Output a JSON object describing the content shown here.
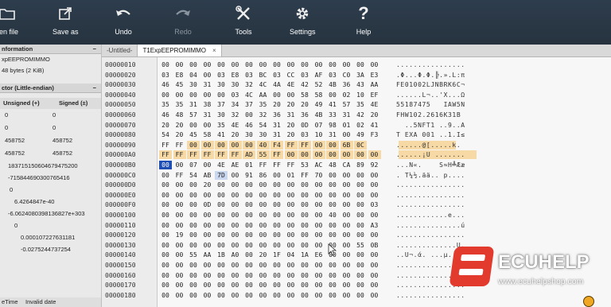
{
  "toolbar": {
    "open": "pen file",
    "save_as": "Save as",
    "undo": "Undo",
    "redo": "Redo",
    "tools": "Tools",
    "settings": "Settings",
    "help": "Help"
  },
  "sidebar": {
    "info_title": "nformation",
    "file_name": "xpEEPROMIMMO",
    "file_size": "48 bytes (2 KiB)",
    "vector_title": "ctor (Little-endian)",
    "col_unsigned": "Unsigned (+)",
    "col_signed": "Signed (±)",
    "rows": [
      {
        "a": "0",
        "b": "0"
      },
      {
        "a": "0",
        "b": "0"
      },
      {
        "a": "458752",
        "b": "458752"
      },
      {
        "a": "458752",
        "b": "458752"
      }
    ],
    "singles": [
      "18371515060467947520​0",
      "-715844690300765416",
      "0",
      "6.4264847e-40",
      "-6.0624080398136827e+303",
      "0",
      "0.000107227631181",
      "-0.0275244737254"
    ],
    "bottom_label": "eTime",
    "bottom_value": "Invalid date"
  },
  "tabs": [
    {
      "label": "-Untitled-",
      "active": false
    },
    {
      "label": "T1ExpEEPROMIMMO",
      "active": true
    }
  ],
  "hex": {
    "offsets": [
      "00000010",
      "00000020",
      "00000030",
      "00000040",
      "00000050",
      "00000060",
      "00000070",
      "00000080",
      "00000090",
      "000000A0",
      "000000B0",
      "000000C0",
      "000000D0",
      "000000E0",
      "000000F0",
      "00000100",
      "00000110",
      "00000120",
      "00000130",
      "00000140",
      "00000150",
      "00000160",
      "00000170",
      "00000180"
    ],
    "rows": [
      [
        "00",
        "00",
        "00",
        "00",
        "00",
        "00",
        "00",
        "00",
        "00",
        "00",
        "00",
        "00",
        "00",
        "00",
        "00",
        "00"
      ],
      [
        "03",
        "E8",
        "04",
        "00",
        "03",
        "E8",
        "03",
        "BC",
        "03",
        "CC",
        "03",
        "AF",
        "03",
        "C0",
        "3A",
        "E3"
      ],
      [
        "46",
        "45",
        "30",
        "31",
        "30",
        "30",
        "32",
        "4C",
        "4A",
        "4E",
        "42",
        "52",
        "4B",
        "36",
        "43",
        "AA"
      ],
      [
        "00",
        "00",
        "00",
        "00",
        "00",
        "03",
        "4C",
        "AA",
        "00",
        "00",
        "58",
        "58",
        "00",
        "02",
        "10",
        "EF"
      ],
      [
        "35",
        "35",
        "31",
        "38",
        "37",
        "34",
        "37",
        "35",
        "20",
        "20",
        "20",
        "49",
        "41",
        "57",
        "35",
        "4E"
      ],
      [
        "46",
        "48",
        "57",
        "31",
        "30",
        "32",
        "00",
        "32",
        "36",
        "31",
        "36",
        "4B",
        "33",
        "31",
        "42",
        "20"
      ],
      [
        "20",
        "20",
        "00",
        "00",
        "35",
        "4E",
        "46",
        "54",
        "31",
        "20",
        "0D",
        "07",
        "98",
        "01",
        "02",
        "41"
      ],
      [
        "54",
        "20",
        "45",
        "58",
        "41",
        "20",
        "30",
        "30",
        "31",
        "20",
        "03",
        "10",
        "31",
        "00",
        "49",
        "F3"
      ],
      [
        "FF",
        "FF",
        "00",
        "00",
        "00",
        "00",
        "00",
        "40",
        "F4",
        "FF",
        "FF",
        "00",
        "00",
        "6B",
        "0C",
        ""
      ],
      [
        "FF",
        "FF",
        "FF",
        "FF",
        "FF",
        "FF",
        "AD",
        "55",
        "FF",
        "00",
        "00",
        "00",
        "00",
        "00",
        "00",
        "00"
      ],
      [
        "00",
        "00",
        "07",
        "00",
        "4E",
        "AE",
        "01",
        "FF",
        "FF",
        "FF",
        "53",
        "AC",
        "48",
        "CA",
        "89",
        "92"
      ],
      [
        "00",
        "FF",
        "54",
        "AB",
        "7D",
        "00",
        "91",
        "86",
        "00",
        "01",
        "FF",
        "70",
        "00",
        "00",
        "00",
        "00"
      ],
      [
        "00",
        "00",
        "00",
        "20",
        "00",
        "00",
        "00",
        "00",
        "00",
        "00",
        "00",
        "00",
        "00",
        "00",
        "00",
        "00"
      ],
      [
        "00",
        "00",
        "00",
        "00",
        "00",
        "00",
        "00",
        "00",
        "00",
        "00",
        "00",
        "00",
        "00",
        "00",
        "00",
        "00"
      ],
      [
        "00",
        "00",
        "00",
        "0D",
        "00",
        "00",
        "00",
        "00",
        "00",
        "00",
        "00",
        "00",
        "00",
        "00",
        "00",
        "03"
      ],
      [
        "00",
        "00",
        "00",
        "00",
        "00",
        "00",
        "00",
        "00",
        "00",
        "00",
        "00",
        "00",
        "40",
        "00",
        "00",
        "00"
      ],
      [
        "00",
        "00",
        "00",
        "00",
        "00",
        "00",
        "00",
        "00",
        "00",
        "00",
        "00",
        "00",
        "00",
        "00",
        "00",
        "A3"
      ],
      [
        "00",
        "19",
        "00",
        "00",
        "00",
        "00",
        "00",
        "00",
        "00",
        "00",
        "00",
        "00",
        "00",
        "00",
        "00",
        "00"
      ],
      [
        "00",
        "00",
        "00",
        "00",
        "00",
        "00",
        "00",
        "00",
        "00",
        "00",
        "00",
        "00",
        "00",
        "00",
        "55",
        "0B"
      ],
      [
        "00",
        "00",
        "55",
        "AA",
        "1B",
        "A0",
        "00",
        "20",
        "1F",
        "04",
        "1A",
        "E6",
        "00",
        "00",
        "00",
        "00"
      ],
      [
        "00",
        "00",
        "00",
        "00",
        "00",
        "00",
        "00",
        "00",
        "00",
        "00",
        "00",
        "00",
        "00",
        "00",
        "00",
        "00"
      ],
      [
        "00",
        "00",
        "00",
        "00",
        "00",
        "00",
        "00",
        "00",
        "00",
        "00",
        "00",
        "00",
        "00",
        "00",
        "00",
        "00"
      ],
      [
        "00",
        "00",
        "00",
        "00",
        "00",
        "00",
        "00",
        "00",
        "00",
        "00",
        "00",
        "00",
        "00",
        "00",
        "00",
        "00"
      ],
      [
        "00",
        "00",
        "00",
        "00",
        "00",
        "00",
        "00",
        "00",
        "00",
        "00",
        "00",
        "00",
        "00",
        "00",
        "00",
        "00"
      ]
    ],
    "ascii": [
      "................",
      ".Φ...Φ.Φ.╠.».L:π",
      "FE01002LJNBRK6C¬",
      "......L¬..'X...Ω",
      "55187475   IAW5N",
      "FHW102.2616K31B ",
      "  ..5NFT1 ..9..A",
      "T EXA 001 ..1.I≤",
      "......@[.....k.",
      "......¡U .......",
      "...N«.    S≈H╩Ææ",
      ". T¼½.ää.. p....",
      "................",
      "................",
      "................",
      "............e...",
      "...............ú",
      "................",
      "..............U.",
      "..U¬.ά. ...µ....",
      "................",
      "................",
      "................",
      "................"
    ]
  },
  "watermark": {
    "brand": "ECUHELP",
    "url": "www.ecuhelpshop.com",
    "color": "#e33a2e"
  },
  "icons": {
    "open": "folder-icon",
    "save_as": "save-as-icon",
    "undo": "undo-icon",
    "redo": "redo-icon",
    "tools": "tools-icon",
    "settings": "gear-icon",
    "help": "help-icon"
  }
}
